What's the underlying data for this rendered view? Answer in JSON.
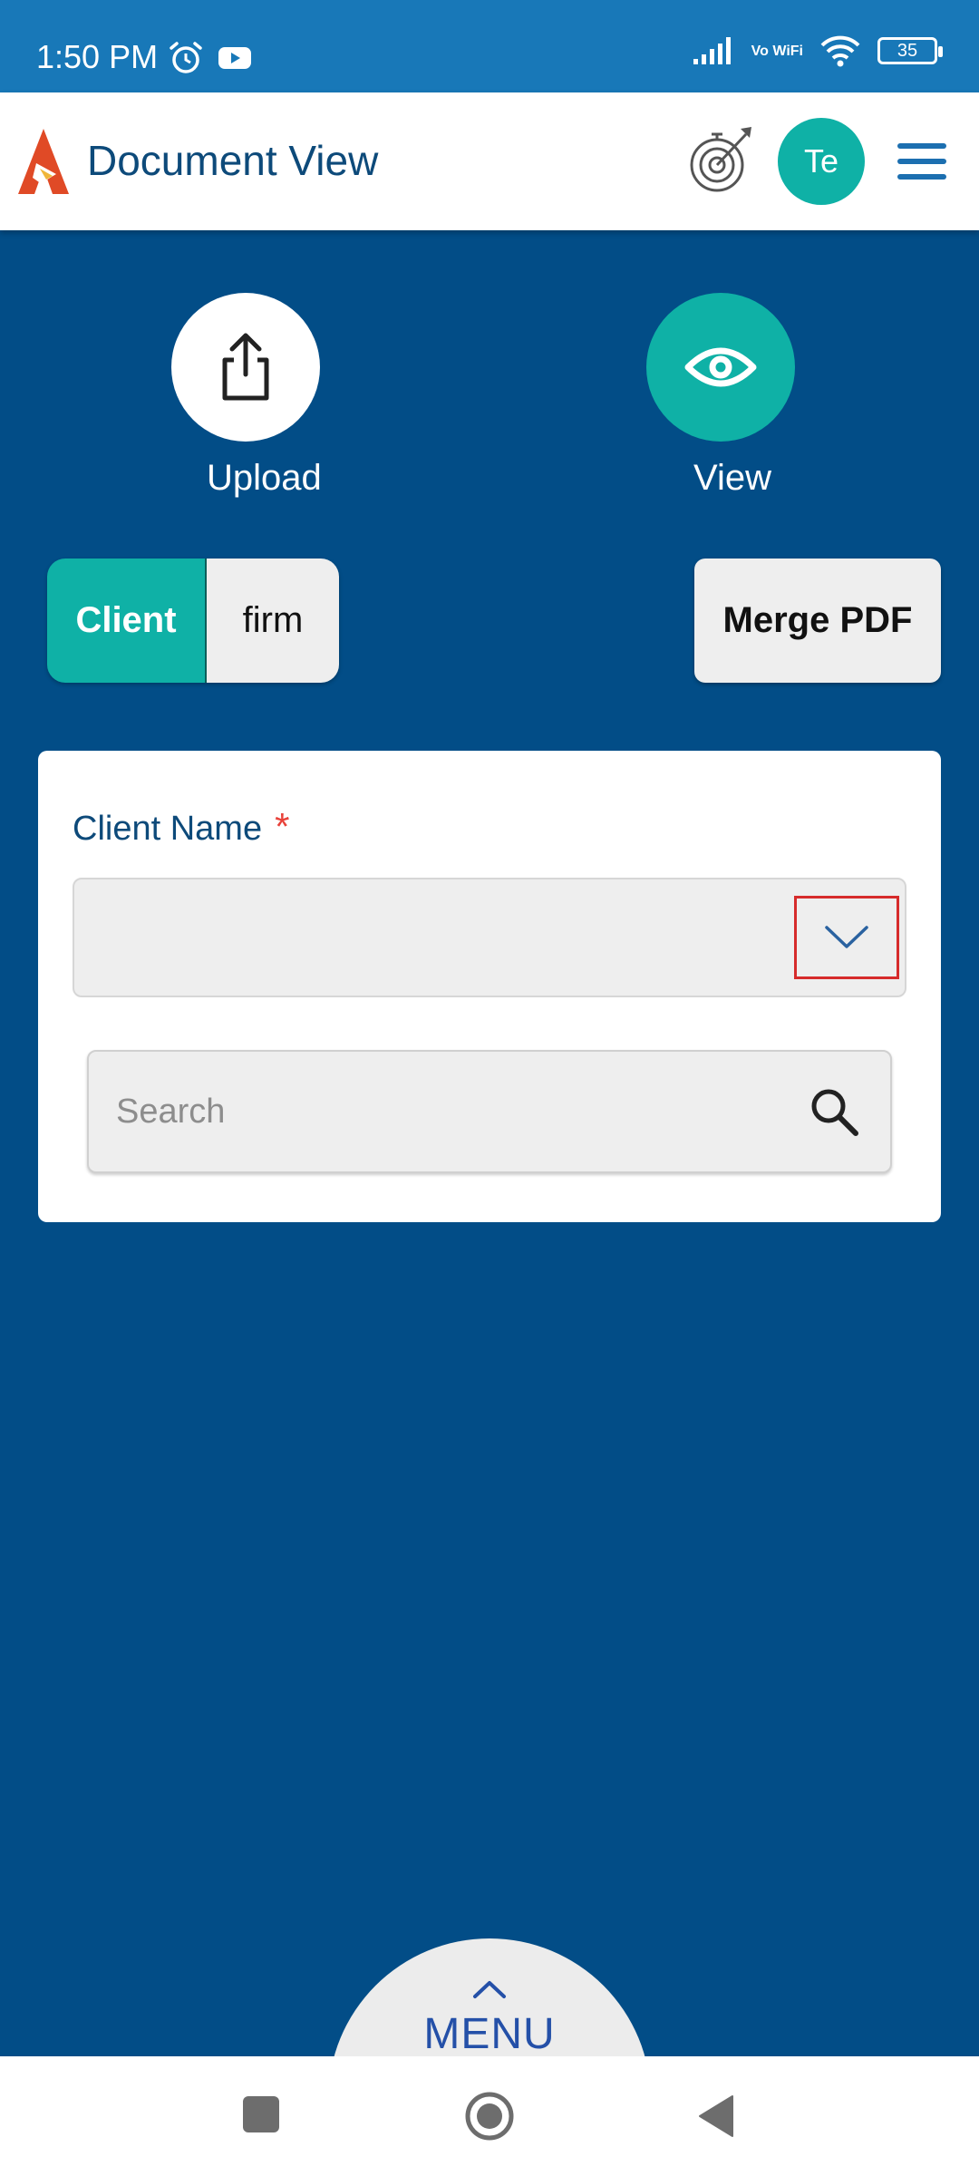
{
  "status_bar": {
    "time": "1:50 PM",
    "network_label": "Vo WiFi",
    "battery": "35",
    "icons": [
      "alarm-icon",
      "youtube-icon",
      "signal-icon",
      "wifi-icon",
      "battery-icon"
    ]
  },
  "header": {
    "title": "Document View",
    "avatar_initials": "Te",
    "icons": [
      "app-logo",
      "goal-target-icon",
      "hamburger-menu-icon"
    ]
  },
  "actions": {
    "upload_label": "Upload",
    "view_label": "View"
  },
  "toggle": {
    "options": [
      "Client",
      "firm"
    ],
    "selected": "Client"
  },
  "merge_pdf_label": "Merge PDF",
  "form": {
    "client_name_label": "Client Name",
    "required_mark": "*",
    "client_name_value": "",
    "search_placeholder": "Search"
  },
  "menu": {
    "label": "MENU"
  },
  "colors": {
    "background": "#024d87",
    "status_bar": "#1878b8",
    "accent_teal": "#0fb1a6",
    "title_blue": "#0d4a7a",
    "required_red": "#e8423a",
    "highlight_red": "#d62b2b"
  }
}
